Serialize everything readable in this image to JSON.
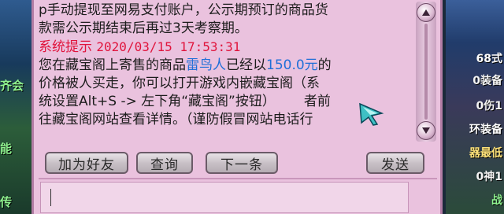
{
  "background": {
    "left_labels": [
      "齐会",
      "能",
      "传"
    ],
    "right_labels": [
      {
        "text": "68式",
        "color": "#ffffff"
      },
      {
        "text": "0装备",
        "color": "#f5f5f5"
      },
      {
        "text": "0伤1",
        "color": "#f5f5f5"
      },
      {
        "text": "环装备",
        "color": "#ffffff"
      },
      {
        "text": "器最低",
        "color": "#ffe37a"
      },
      {
        "text": "0神1",
        "color": "#f5f5f5"
      },
      {
        "text": "战",
        "color": "#8ff28f"
      }
    ]
  },
  "chat": {
    "notice_line1": "p手动提现至网易支付账户，公示期预订的商品货",
    "notice_line2": "款需公示期结束后再过3天考察期。",
    "system_tag": "系统提示",
    "system_time": "2020/03/15 17:53:31",
    "msg_prefix": "您在藏宝阁上寄售的商品",
    "item_name": "雷鸟人",
    "msg_mid": "已经以",
    "price": "150.0元",
    "msg_suffix": "的",
    "msg_line2": "价格被人买走，你可以打开游戏内嵌藏宝阁（系",
    "msg_line3": "统设置Alt+S -> 左下角“藏宝阁”按钮）",
    "msg_line3_tail": "者前",
    "msg_line4": "往藏宝阁网站查看详情。（谨防假冒网站电话行"
  },
  "buttons": {
    "add_friend": "加为好友",
    "query": "查询",
    "next": "下一条",
    "send": "发送"
  },
  "input": {
    "value": ""
  },
  "colors": {
    "window_bg": "#eac2de",
    "system_red": "#e0143c",
    "link_blue": "#1f6fd8"
  }
}
